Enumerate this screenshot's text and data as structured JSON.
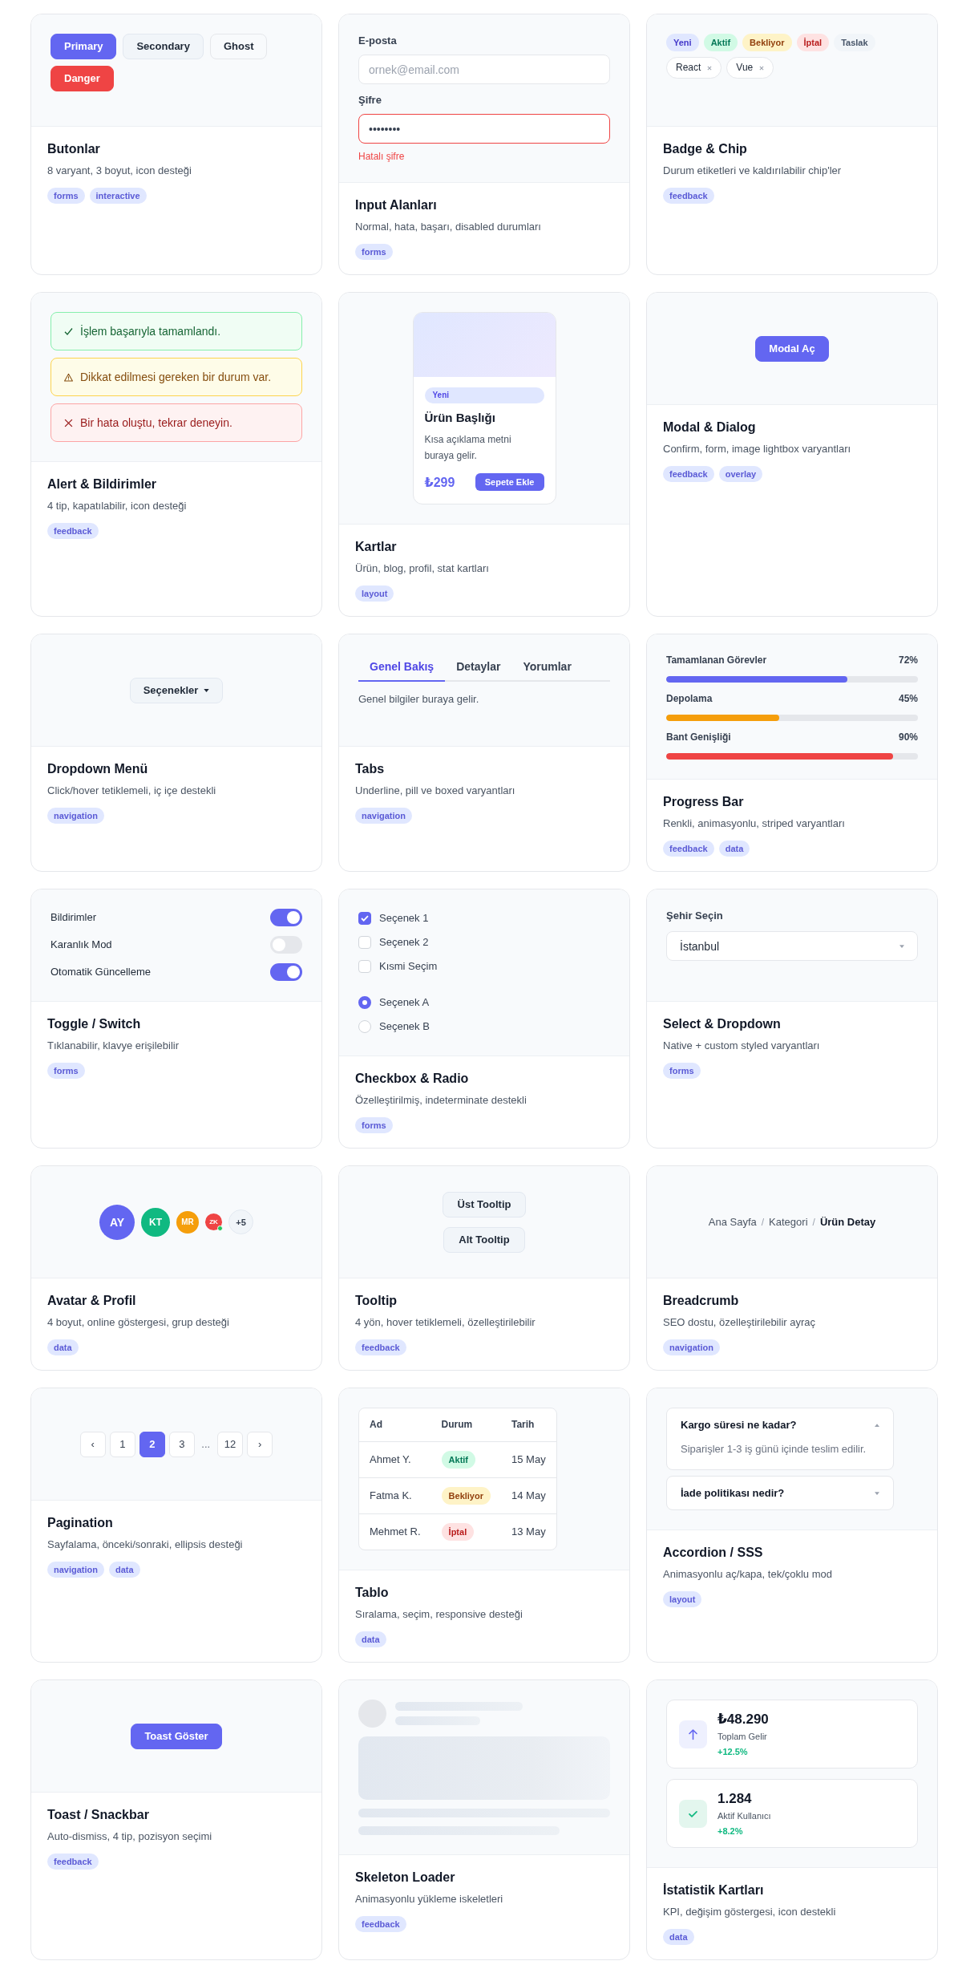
{
  "cards": [
    {
      "kind": "buttons",
      "buttons": [
        {
          "label": "Primary",
          "kind": "primary"
        },
        {
          "label": "Secondary",
          "kind": "secondary"
        },
        {
          "label": "Ghost",
          "kind": "ghost"
        },
        {
          "label": "Danger",
          "kind": "danger"
        }
      ],
      "title": "Butonlar",
      "description": "8 varyant, 3 boyut, icon desteği",
      "tags": [
        "forms",
        "interactive"
      ]
    },
    {
      "kind": "inputs",
      "fields": [
        {
          "label": "E-posta",
          "placeholder": "ornek@email.com",
          "error": false
        },
        {
          "label": "Şifre",
          "value": "••••••••",
          "error": true,
          "message": "Hatalı şifre"
        }
      ],
      "title": "Input Alanları",
      "description": "Normal, hata, başarı, disabled durumları",
      "tags": [
        "forms"
      ]
    },
    {
      "kind": "badges",
      "badges": [
        {
          "label": "Yeni",
          "kind": "info"
        },
        {
          "label": "Aktif",
          "kind": "success"
        },
        {
          "label": "Bekliyor",
          "kind": "warning"
        },
        {
          "label": "İptal",
          "kind": "danger"
        },
        {
          "label": "Taslak",
          "kind": "neutral"
        }
      ],
      "chips": [
        "React",
        "Vue"
      ],
      "title": "Badge & Chip",
      "description": "Durum etiketleri ve kaldırılabilir chip'ler",
      "tags": [
        "feedback"
      ]
    },
    {
      "kind": "alerts",
      "alerts": [
        {
          "kind": "success",
          "message": "İşlem başarıyla tamamlandı."
        },
        {
          "kind": "warning",
          "message": "Dikkat edilmesi gereken bir durum var."
        },
        {
          "kind": "error",
          "message": "Bir hata oluştu, tekrar deneyin."
        }
      ],
      "title": "Alert & Bildirimler",
      "description": "4 tip, kapatılabilir, icon desteği",
      "tags": [
        "feedback"
      ]
    },
    {
      "kind": "product",
      "product": {
        "badge": "Yeni",
        "title": "Ürün Başlığı",
        "description": "Kısa açıklama metni buraya gelir.",
        "price": "₺299",
        "button": "Sepete Ekle"
      },
      "title": "Kartlar",
      "description": "Ürün, blog, profil, stat kartları",
      "tags": [
        "layout"
      ]
    },
    {
      "kind": "action",
      "button": "Modal Aç",
      "title": "Modal & Dialog",
      "description": "Confirm, form, image lightbox varyantları",
      "tags": [
        "feedback",
        "overlay"
      ]
    },
    {
      "kind": "dropdown",
      "button": "Seçenekler",
      "title": "Dropdown Menü",
      "description": "Click/hover tetiklemeli, iç içe destekli",
      "tags": [
        "navigation"
      ]
    },
    {
      "kind": "tabs",
      "tabs": [
        {
          "label": "Genel Bakış",
          "selected": true
        },
        {
          "label": "Detaylar",
          "selected": false
        },
        {
          "label": "Yorumlar",
          "selected": false
        }
      ],
      "content": "Genel bilgiler buraya gelir.",
      "title": "Tabs",
      "description": "Underline, pill ve boxed varyantları",
      "tags": [
        "navigation"
      ]
    },
    {
      "kind": "progress",
      "items": [
        {
          "label": "Tamamlanan Görevler",
          "reading": "72%",
          "level": 0.72,
          "color": "#6366f1"
        },
        {
          "label": "Depolama",
          "reading": "45%",
          "level": 0.45,
          "color": "#f59e0b"
        },
        {
          "label": "Bant Genişliği",
          "reading": "90%",
          "level": 0.9,
          "color": "#ef4444"
        }
      ],
      "title": "Progress Bar",
      "description": "Renkli, animasyonlu, striped varyantları",
      "tags": [
        "feedback",
        "data"
      ]
    },
    {
      "kind": "toggles",
      "toggles": [
        {
          "label": "Bildirimler",
          "on": true
        },
        {
          "label": "Karanlık Mod",
          "on": false
        },
        {
          "label": "Otomatik Güncelleme",
          "on": true
        }
      ],
      "title": "Toggle / Switch",
      "description": "Tıklanabilir, klavye erişilebilir",
      "tags": [
        "forms"
      ]
    },
    {
      "kind": "choices",
      "checkboxes": [
        {
          "label": "Seçenek 1",
          "checked": true
        },
        {
          "label": "Seçenek 2",
          "checked": false
        },
        {
          "label": "Kısmi Seçim",
          "checked": false
        }
      ],
      "radios": [
        {
          "label": "Seçenek A",
          "selected": true
        },
        {
          "label": "Seçenek B",
          "selected": false
        }
      ],
      "title": "Checkbox & Radio",
      "description": "Özelleştirilmiş, indeterminate destekli",
      "tags": [
        "forms"
      ]
    },
    {
      "kind": "select",
      "label": "Şehir Seçin",
      "value": "İstanbul",
      "title": "Select & Dropdown",
      "description": "Native + custom styled varyantları",
      "tags": [
        "forms"
      ]
    },
    {
      "kind": "avatars",
      "avatars": [
        {
          "kind": "xl",
          "text": "AY",
          "color": "#6366f1",
          "online": false
        },
        {
          "kind": "lg",
          "text": "KT",
          "color": "#10b981",
          "online": false
        },
        {
          "kind": "md",
          "text": "MR",
          "color": "#f59e0b",
          "online": false
        },
        {
          "kind": "sm",
          "text": "ZK",
          "color": "#ef4444",
          "online": true
        },
        {
          "kind": "count",
          "text": "+5"
        }
      ],
      "title": "Avatar & Profil",
      "description": "4 boyut, online göstergesi, grup desteği",
      "tags": [
        "data"
      ]
    },
    {
      "kind": "tooltips",
      "buttons": [
        "Üst Tooltip",
        "Alt Tooltip"
      ],
      "title": "Tooltip",
      "description": "4 yön, hover tetiklemeli, özelleştirilebilir",
      "tags": [
        "feedback"
      ]
    },
    {
      "kind": "breadcrumb",
      "crumbs": [
        {
          "label": "Ana Sayfa",
          "current": false
        },
        {
          "separator": "/",
          "label": "Kategori",
          "current": false
        },
        {
          "separator": "/",
          "label": "Ürün Detay",
          "current": true
        }
      ],
      "title": "Breadcrumb",
      "description": "SEO dostu, özelleştirilebilir ayraç",
      "tags": [
        "navigation"
      ]
    },
    {
      "kind": "pagination",
      "pages": [
        {
          "label": "‹",
          "kind": "prev",
          "selected": false
        },
        {
          "label": "1",
          "kind": "page",
          "selected": false
        },
        {
          "label": "2",
          "kind": "page",
          "selected": true
        },
        {
          "label": "3",
          "kind": "page",
          "selected": false
        },
        {
          "label": "...",
          "kind": "ellipsis",
          "selected": false
        },
        {
          "label": "12",
          "kind": "page",
          "selected": false
        },
        {
          "label": "›",
          "kind": "next",
          "selected": false
        }
      ],
      "title": "Pagination",
      "description": "Sayfalama, önceki/sonraki, ellipsis desteği",
      "tags": [
        "navigation",
        "data"
      ]
    },
    {
      "kind": "table",
      "columns": [
        "Ad",
        "Durum",
        "Tarih"
      ],
      "rows": [
        {
          "name": "Ahmet Y.",
          "status": {
            "label": "Aktif",
            "kind": "success"
          },
          "date": "15 May"
        },
        {
          "name": "Fatma K.",
          "status": {
            "label": "Bekliyor",
            "kind": "warning"
          },
          "date": "14 May"
        },
        {
          "name": "Mehmet R.",
          "status": {
            "label": "İptal",
            "kind": "danger"
          },
          "date": "13 May"
        }
      ],
      "title": "Tablo",
      "description": "Sıralama, seçim, responsive desteği",
      "tags": [
        "data"
      ]
    },
    {
      "kind": "accordion",
      "items": [
        {
          "question": "Kargo süresi ne kadar?",
          "answer": "Siparişler 1-3 iş günü içinde teslim edilir.",
          "expanded": true
        },
        {
          "question": "İade politikası nedir?",
          "expanded": false
        }
      ],
      "title": "Accordion / SSS",
      "description": "Animasyonlu aç/kapa, tek/çoklu mod",
      "tags": [
        "layout"
      ]
    },
    {
      "kind": "action",
      "button": "Toast Göster",
      "title": "Toast / Snackbar",
      "description": "Auto-dismiss, 4 tip, pozisyon seçimi",
      "tags": [
        "feedback"
      ]
    },
    {
      "kind": "skeleton",
      "title": "Skeleton Loader",
      "description": "Animasyonlu yükleme iskeletleri",
      "tags": [
        "feedback"
      ]
    },
    {
      "kind": "stats",
      "stats": [
        {
          "kind": "primary",
          "value": "₺48.290",
          "label": "Toplam Gelir",
          "change": "+12.5%"
        },
        {
          "kind": "success",
          "value": "1.284",
          "label": "Aktif Kullanıcı",
          "change": "+8.2%"
        }
      ],
      "title": "İstatistik Kartları",
      "description": "KPI, değişim göstergesi, icon destekli",
      "tags": [
        "data"
      ]
    }
  ]
}
